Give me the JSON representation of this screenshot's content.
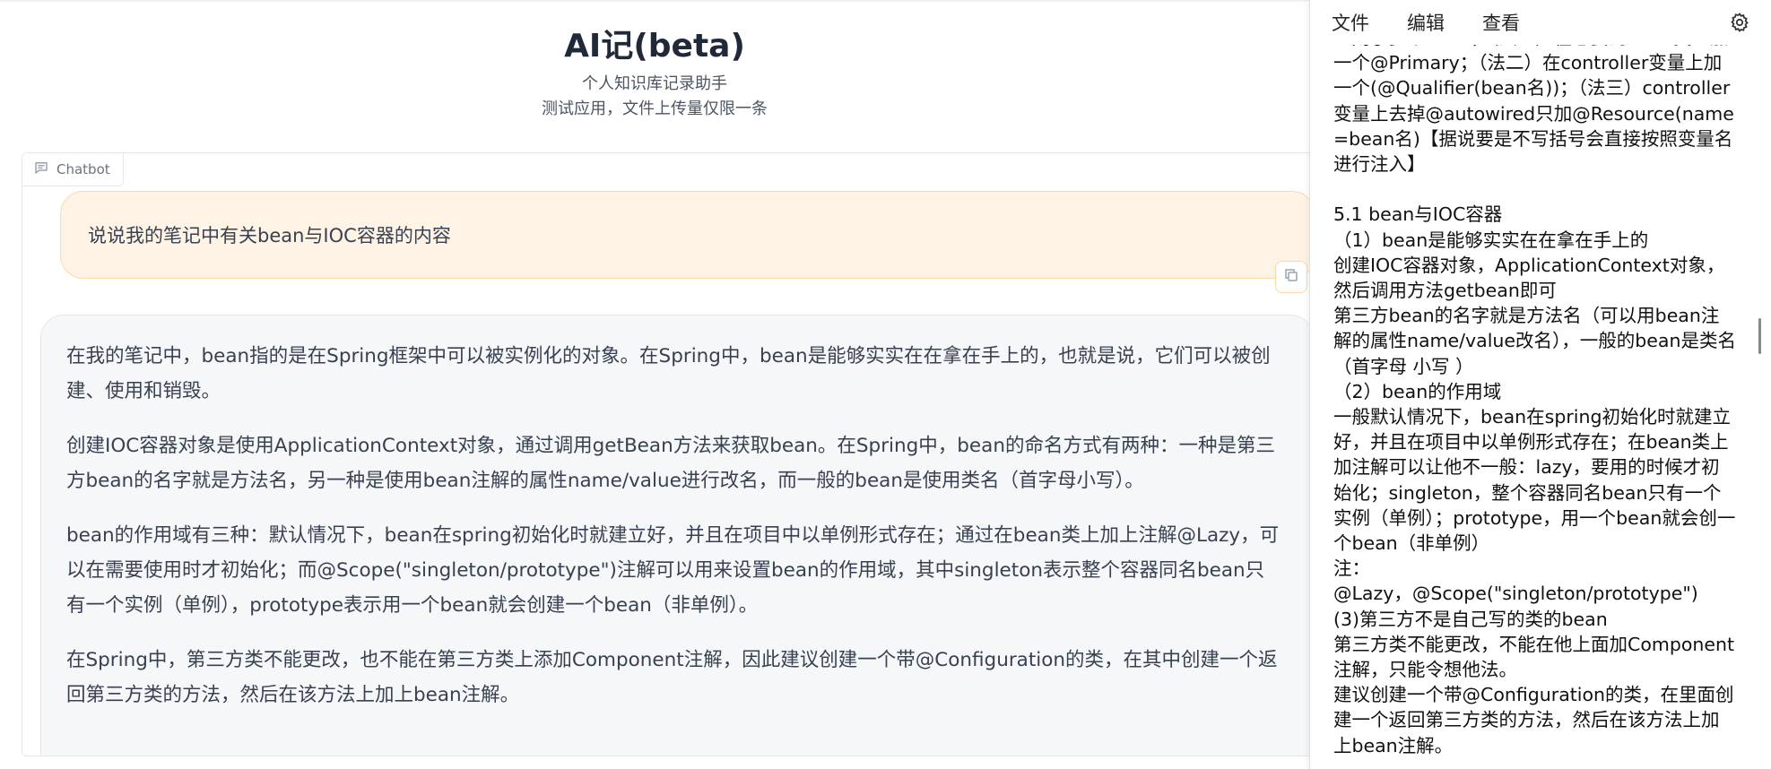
{
  "app": {
    "title": "AI记(beta)",
    "subtitle_line1": "个人知识库记录助手",
    "subtitle_line2": "测试应用，文件上传量仅限一条"
  },
  "chatbot": {
    "label": "Chatbot",
    "icon": "chat-bubble-icon",
    "user_message": "说说我的笔记中有关bean与IOC容器的内容",
    "copy_icon": "copy-icon",
    "bot_paragraphs": [
      "在我的笔记中，bean指的是在Spring框架中可以被实例化的对象。在Spring中，bean是能够实实在在拿在手上的，也就是说，它们可以被创建、使用和销毁。",
      "创建IOC容器对象是使用ApplicationContext对象，通过调用getBean方法来获取bean。在Spring中，bean的命名方式有两种：一种是第三方bean的名字就是方法名，另一种是使用bean注解的属性name/value进行改名，而一般的bean是使用类名（首字母小写）。",
      "bean的作用域有三种：默认情况下，bean在spring初始化时就建立好，并且在项目中以单例形式存在；通过在bean类上加上注解@Lazy，可以在需要使用时才初始化；而@Scope(\"singleton/prototype\")注解可以用来设置bean的作用域，其中singleton表示整个容器同名bean只有一个实例（单例），prototype表示用一个bean就会创建一个bean（非单例）。",
      "在Spring中，第三方类不能更改，也不能在第三方类上添加Component注解，因此建议创建一个带@Configuration的类，在其中创建一个返回第三方类的方法，然后在该方法上加上bean注解。"
    ]
  },
  "side_panel": {
    "menu": [
      "文件",
      "编辑",
      "查看"
    ],
    "settings_icon": "gear-icon",
    "note_text": "上则了多个bean，（法一）在想要的bean类上加一个@Primary；（法二）在controller变量上加一个(@Qualifier(bean名))；（法三）controller变量上去掉@autowired只加@Resource(name=bean名)【据说要是不写括号会直接按照变量名进行注入】\n\n5.1 bean与IOC容器\n（1）bean是能够实实在在拿在手上的\n创建IOC容器对象，ApplicationContext对象，然后调用方法getbean即可\n第三方bean的名字就是方法名（可以用bean注解的属性name/value改名），一般的bean是类名（首字母 小写 ）\n（2）bean的作用域\n一般默认情况下，bean在spring初始化时就建立好，并且在项目中以单例形式存在；在bean类上加注解可以让他不一般：lazy，要用的时候才初始化；singleton，整个容器同名bean只有一个实例（单例）；prototype，用一个bean就会创一个bean（非单例）\n注：\n@Lazy，@Scope(\"singleton/prototype\")\n(3)第三方不是自己写的类的bean\n第三方类不能更改，不能在他上面加Component注解，只能令想他法。\n建议创建一个带@Configuration的类，在里面创建一个返回第三方类的方法，然后在该方法上加上bean注解。"
  }
}
